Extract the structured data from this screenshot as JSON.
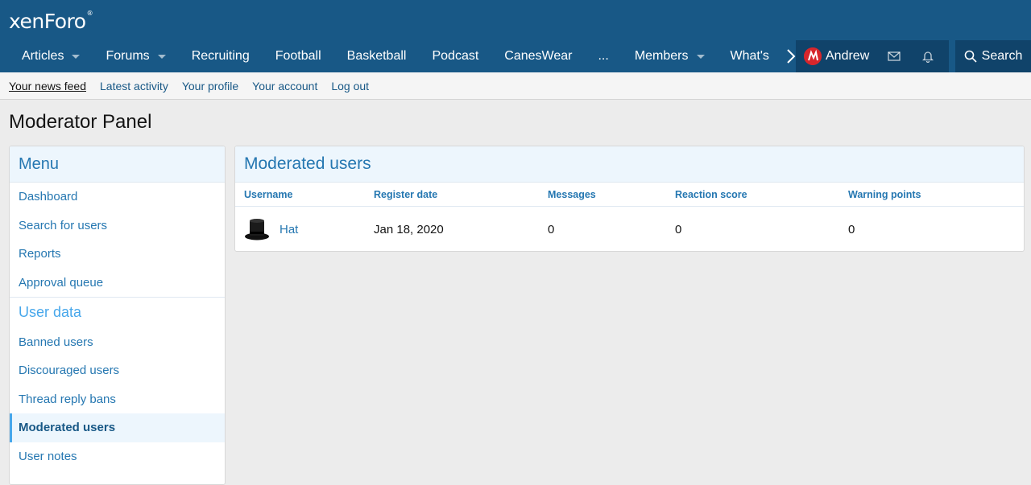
{
  "logo": {
    "text": "xenForo",
    "mark": "®"
  },
  "nav": {
    "items": [
      {
        "label": "Articles",
        "dropdown": true
      },
      {
        "label": "Forums",
        "dropdown": true
      },
      {
        "label": "Recruiting",
        "dropdown": false
      },
      {
        "label": "Football",
        "dropdown": false
      },
      {
        "label": "Basketball",
        "dropdown": false
      },
      {
        "label": "Podcast",
        "dropdown": false
      },
      {
        "label": "CanesWear",
        "dropdown": false
      },
      {
        "label": "...",
        "dropdown": false
      },
      {
        "label": "Members",
        "dropdown": true
      },
      {
        "label": "What's",
        "dropdown": false
      }
    ],
    "more_glyph": "›",
    "user_name": "Andrew",
    "search_label": "Search"
  },
  "subnav": [
    "Your news feed",
    "Latest activity",
    "Your profile",
    "Your account",
    "Log out"
  ],
  "page_title": "Moderator Panel",
  "sidebar": {
    "menu_title": "Menu",
    "menu_items": [
      "Dashboard",
      "Search for users",
      "Reports",
      "Approval queue"
    ],
    "section_title": "User data",
    "section_items": [
      "Banned users",
      "Discouraged users",
      "Thread reply bans",
      "Moderated users",
      "User notes"
    ],
    "selected": "Moderated users"
  },
  "main": {
    "title": "Moderated users",
    "columns": [
      "Username",
      "Register date",
      "Messages",
      "Reaction score",
      "Warning points"
    ],
    "rows": [
      {
        "username": "Hat",
        "register_date": "Jan 18, 2020",
        "messages": "0",
        "reaction_score": "0",
        "warning_points": "0"
      }
    ]
  },
  "colors": {
    "header": "#185886",
    "account_bg": "#10436a",
    "link": "#2577b1",
    "accent": "#47a7eb"
  }
}
